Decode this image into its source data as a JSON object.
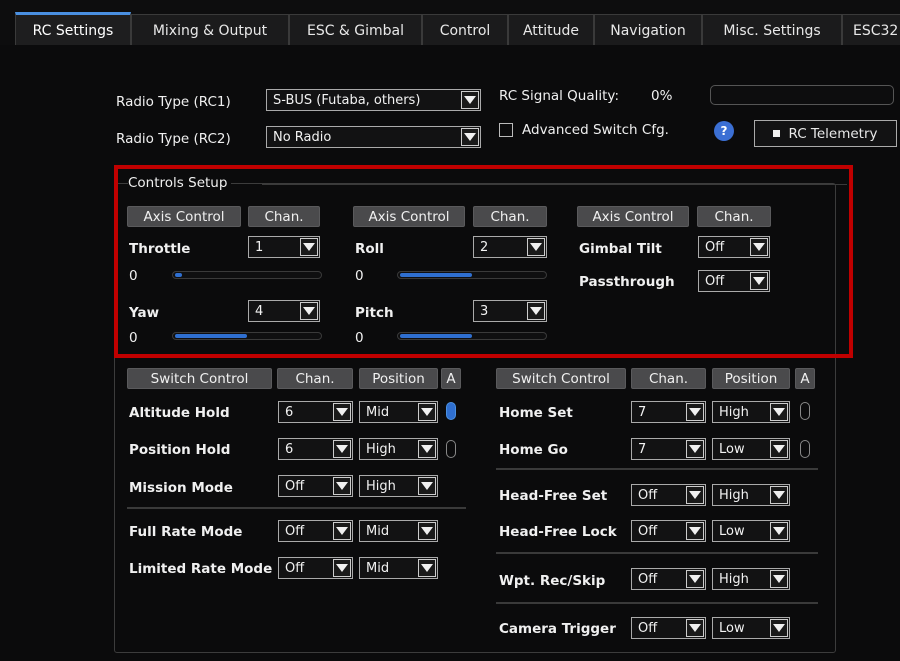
{
  "tabs": [
    {
      "label": "RC Settings"
    },
    {
      "label": "Mixing & Output"
    },
    {
      "label": "ESC & Gimbal"
    },
    {
      "label": "Control"
    },
    {
      "label": "Attitude"
    },
    {
      "label": "Navigation"
    },
    {
      "label": "Misc. Settings"
    },
    {
      "label": "ESC32"
    }
  ],
  "radio": {
    "rc1_label": "Radio Type (RC1)",
    "rc1_value": "S-BUS (Futaba, others)",
    "rc2_label": "Radio Type (RC2)",
    "rc2_value": "No Radio",
    "signal_label": "RC Signal Quality:",
    "signal_value": "0%",
    "signal_quality": 0,
    "adv_switch_label": "Advanced Switch Cfg.",
    "help_glyph": "?",
    "telemetry_label": "RC Telemetry"
  },
  "controls": {
    "title": "Controls Setup",
    "axis_header": "Axis Control",
    "chan_header": "Chan.",
    "throttle": {
      "label": "Throttle",
      "chan": "1",
      "value": "0",
      "level": 0.05
    },
    "yaw": {
      "label": "Yaw",
      "chan": "4",
      "value": "0",
      "level": 0.5
    },
    "roll": {
      "label": "Roll",
      "chan": "2",
      "value": "0",
      "level": 0.5
    },
    "pitch": {
      "label": "Pitch",
      "chan": "3",
      "value": "0",
      "level": 0.5
    },
    "gimbal_tilt": {
      "label": "Gimbal Tilt",
      "chan": "Off"
    },
    "passthrough": {
      "label": "Passthrough",
      "chan": "Off"
    }
  },
  "switches": {
    "switch_header": "Switch Control",
    "chan_header": "Chan.",
    "pos_header": "Position",
    "a_header": "A",
    "left": [
      {
        "label": "Altitude Hold",
        "chan": "6",
        "pos": "Mid",
        "active": true
      },
      {
        "label": "Position Hold",
        "chan": "6",
        "pos": "High",
        "active": false
      },
      {
        "label": "Mission Mode",
        "chan": "Off",
        "pos": "High"
      },
      {
        "label": "Full Rate Mode",
        "chan": "Off",
        "pos": "Mid"
      },
      {
        "label": "Limited Rate Mode",
        "chan": "Off",
        "pos": "Mid"
      }
    ],
    "right": [
      {
        "label": "Home Set",
        "chan": "7",
        "pos": "High",
        "active": false
      },
      {
        "label": "Home Go",
        "chan": "7",
        "pos": "Low",
        "active": false
      },
      {
        "label": "Head-Free Set",
        "chan": "Off",
        "pos": "High"
      },
      {
        "label": "Head-Free Lock",
        "chan": "Off",
        "pos": "Low"
      },
      {
        "label": "Wpt. Rec/Skip",
        "chan": "Off",
        "pos": "High"
      },
      {
        "label": "Camera Trigger",
        "chan": "Off",
        "pos": "Low"
      }
    ]
  },
  "colors": {
    "accent": "#2f6fd0",
    "highlight": "#c00000"
  }
}
